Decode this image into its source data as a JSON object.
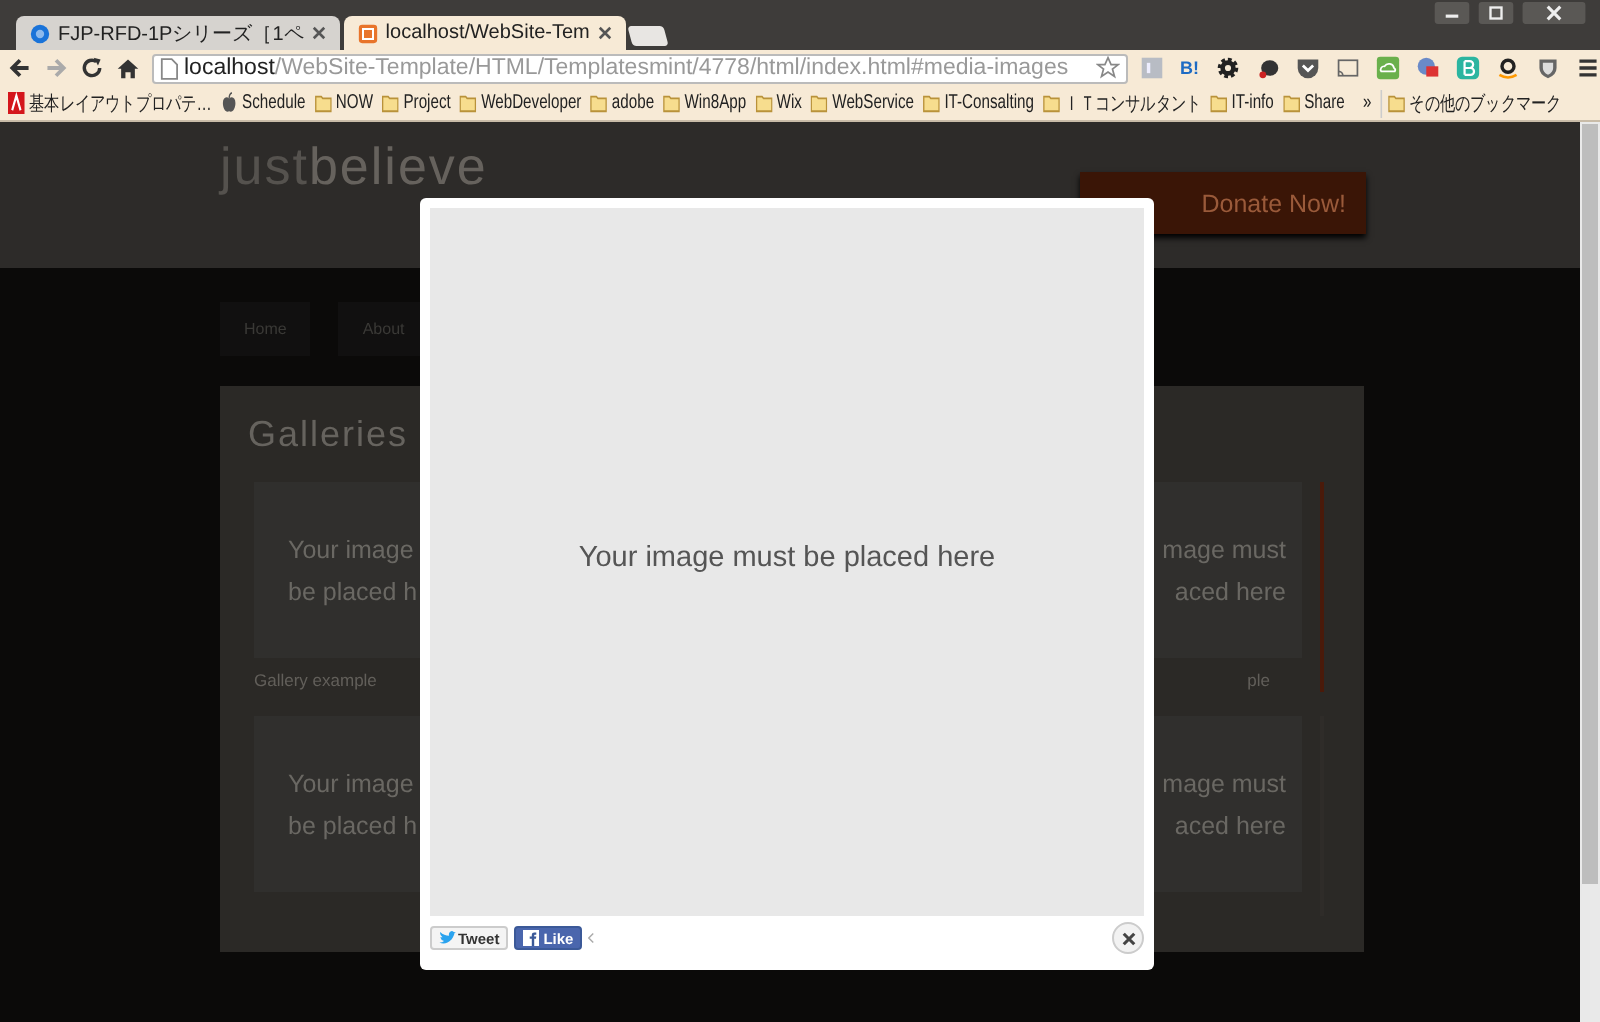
{
  "tabs": [
    {
      "title": "FJP-RFD-1Pシリーズ［1ペ",
      "selected": false
    },
    {
      "title": "localhost/WebSite-Tem",
      "selected": true
    }
  ],
  "toolbar": {
    "url_host": "localhost",
    "url_path": "/WebSite-Template/HTML/Templatesmint/4778/html/index.html#media-images",
    "extension_text": "B!"
  },
  "bookmarks": [
    {
      "kind": "adobe",
      "label": "基本レイアウトプロパテ…"
    },
    {
      "kind": "apple",
      "label": "Schedule"
    },
    {
      "kind": "folder",
      "label": "NOW"
    },
    {
      "kind": "folder",
      "label": "Project"
    },
    {
      "kind": "folder",
      "label": "WebDeveloper"
    },
    {
      "kind": "folder",
      "label": "adobe"
    },
    {
      "kind": "folder",
      "label": "Win8App"
    },
    {
      "kind": "folder",
      "label": "Wix"
    },
    {
      "kind": "folder",
      "label": "WebService"
    },
    {
      "kind": "folder",
      "label": "IT-Consalting"
    },
    {
      "kind": "folder",
      "label": "ＩＴコンサルタント"
    },
    {
      "kind": "folder",
      "label": "IT-info"
    },
    {
      "kind": "folder",
      "label": "Share"
    }
  ],
  "bookmarks_overflow": "»",
  "other_bookmarks": "その他のブックマーク",
  "site": {
    "logo_light": "just",
    "logo_bold": "believe",
    "donate_button": "Donate Now!",
    "nav": [
      "Home",
      "About"
    ],
    "section_title": "Galleries",
    "left_card": [
      "Your image",
      "be placed h"
    ],
    "right_card": [
      "mage must",
      "aced here"
    ],
    "left_caption": "Gallery example",
    "right_caption": "ple",
    "left_card_2": [
      "Your image",
      "be placed h"
    ],
    "right_card_2": [
      "mage must",
      "aced here"
    ]
  },
  "lightbox": {
    "image_text": "Your image must be placed here",
    "tweet_button": "Tweet",
    "like_button": "Like"
  }
}
